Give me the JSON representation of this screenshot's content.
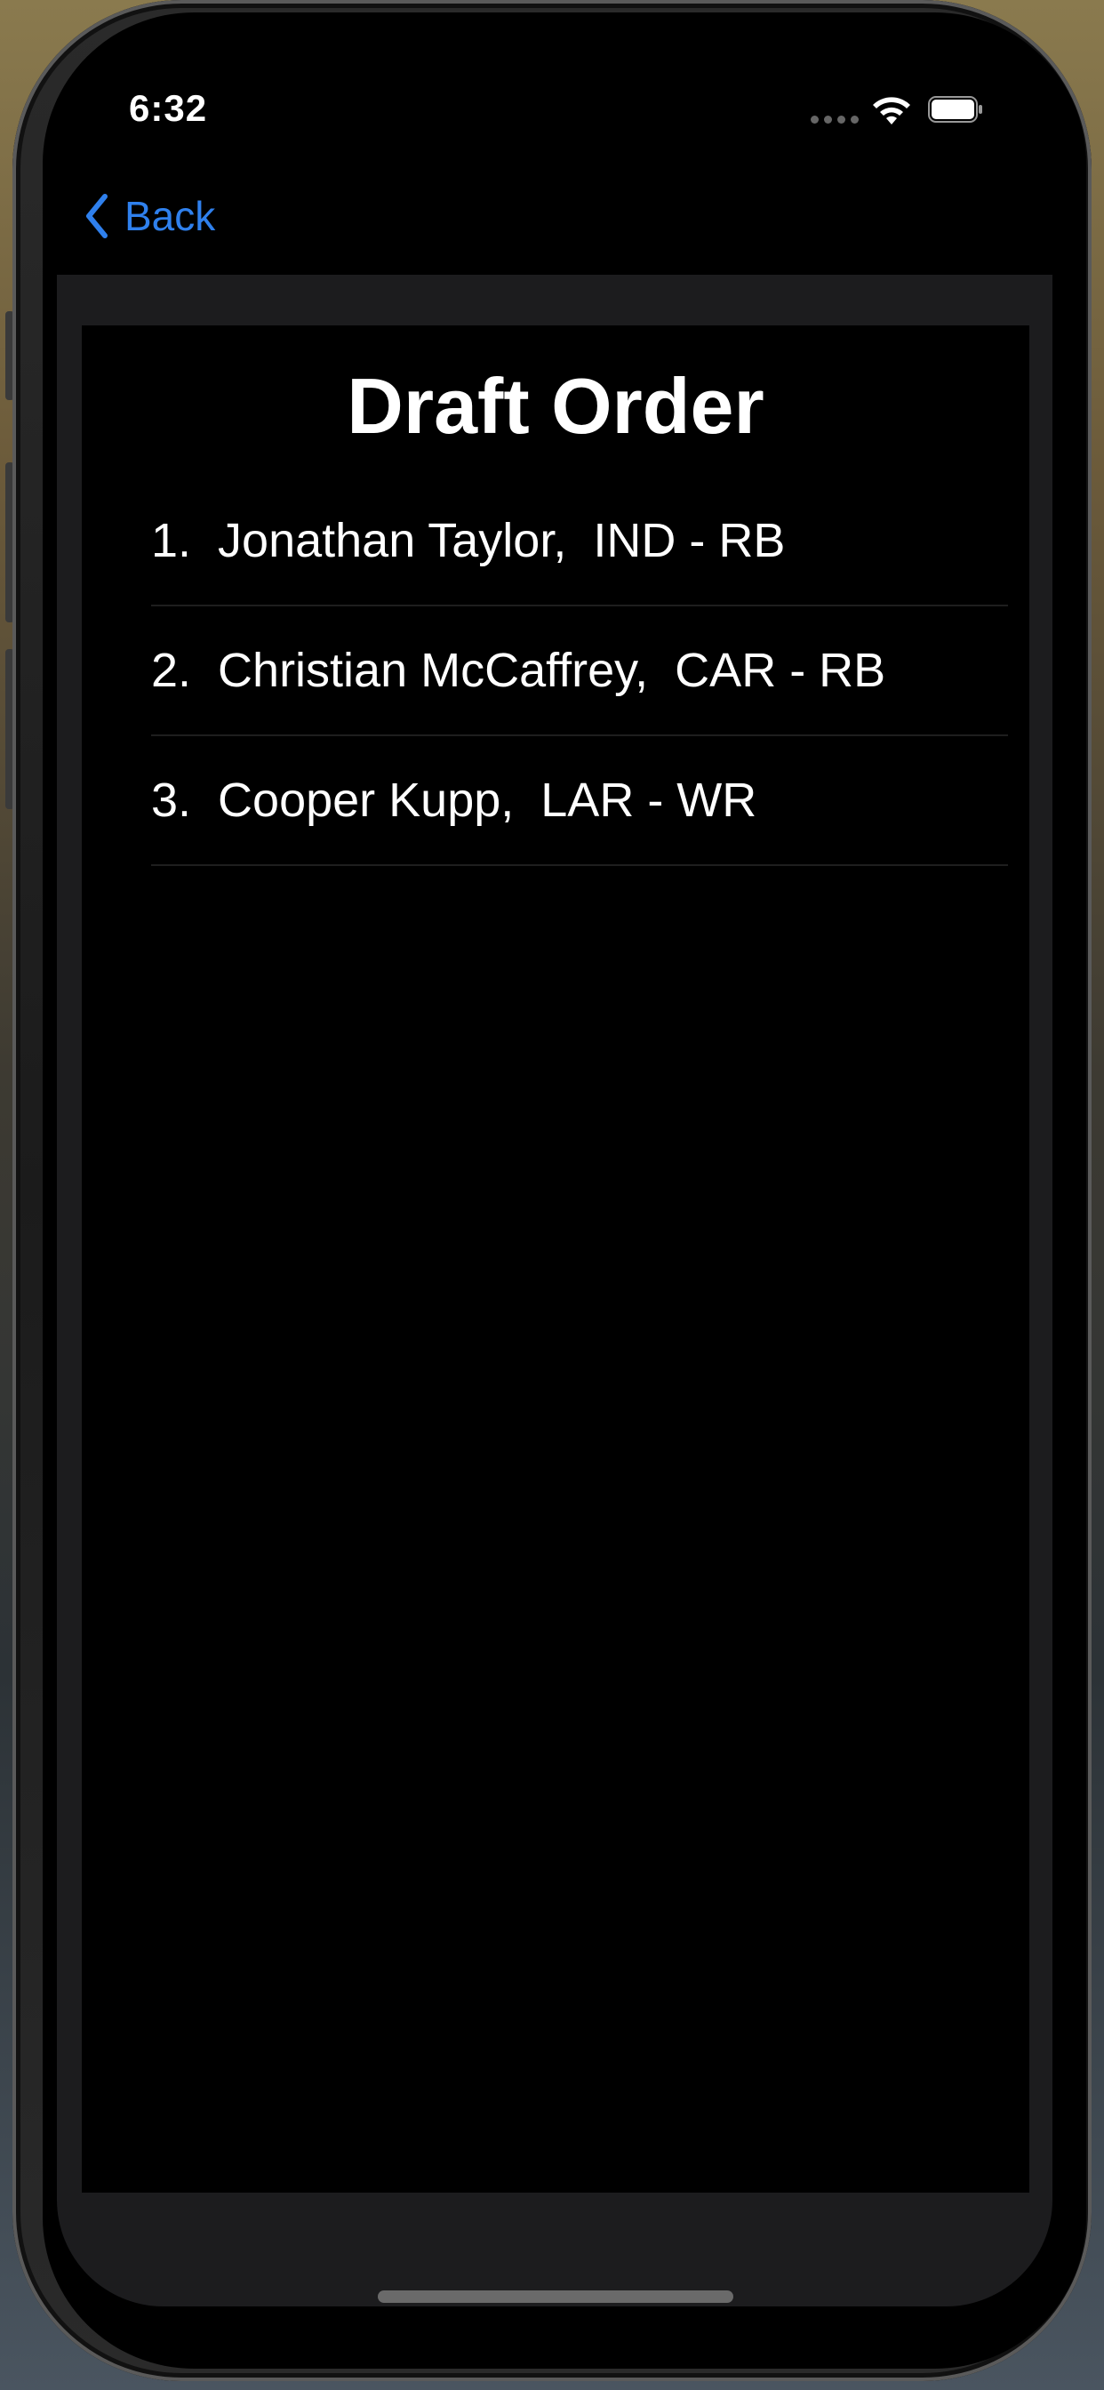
{
  "status_bar": {
    "time": "6:32"
  },
  "nav": {
    "back_label": "Back"
  },
  "screen": {
    "title": "Draft Order",
    "picks": [
      "1.  Jonathan Taylor,  IND - RB",
      "2.  Christian McCaffrey,  CAR - RB",
      "3.  Cooper Kupp,  LAR - WR"
    ]
  },
  "colors": {
    "accent": "#2f80ed",
    "background": "#000000",
    "sheet": "#1c1c1e",
    "text": "#ffffff"
  },
  "icons": {
    "back": "chevron-left-icon",
    "wifi": "wifi-icon",
    "battery": "battery-icon",
    "signal": "signal-dots-icon"
  }
}
